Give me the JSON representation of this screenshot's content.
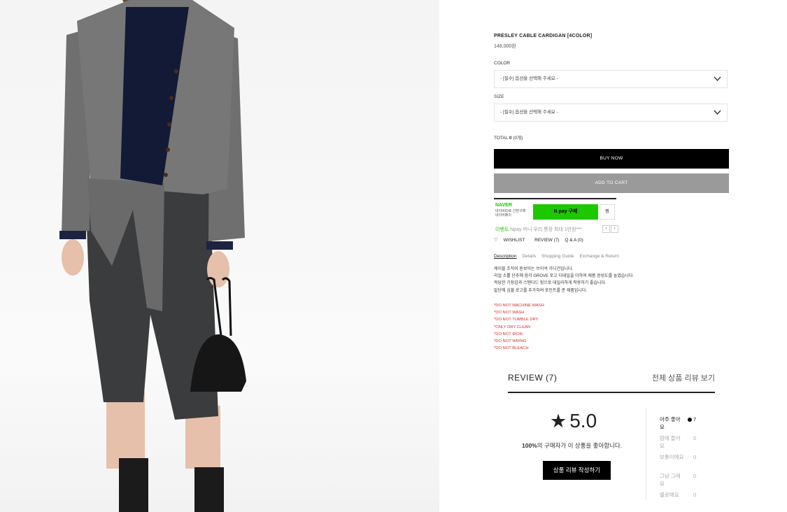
{
  "product": {
    "title": "PRESLEY CABLE CARDIGAN [4COLOR]",
    "price": "148,000원"
  },
  "options": [
    {
      "label": "COLOR",
      "placeholder": "- [필수] 옵션을 선택해 주세요 -"
    },
    {
      "label": "SIZE",
      "placeholder": "- [필수] 옵션을 선택해 주세요 -"
    }
  ],
  "total": {
    "label": "TOTAL",
    "amount": "0",
    "count": "(0개)"
  },
  "buttons": {
    "buy_now": "BUY NOW",
    "add_to_cart": "ADD TO CART"
  },
  "npay": {
    "brand": "NAVER",
    "sub_line1": "네이버ID로 간편구매",
    "sub_line2": "네이버페이",
    "pay_label": "N pay 구매",
    "zzim_label": "찜",
    "event_prefix": "이벤트",
    "event_text": "Npay 머니 우리 통장 최대 1만원***"
  },
  "links": {
    "wishlist": "WISHLIST",
    "review": "REVIEW (7)",
    "qa": "Q & A (0)"
  },
  "tabs": [
    "Description",
    "Details",
    "Shopping Guide",
    "Exchange & Return"
  ],
  "description": [
    "케이블 조직이 돋보이는 브이넥 가디건입니다.",
    "리얼 소뿔 단추에 음각 GROVE 로고 디테일을 더하여 제품 완성도를 높였습니다.",
    "적당한 기장감과 스탠다드 핏으로 데일리하게 착용하기 좋습니다.",
    "밑단에 심볼 로고를 추가하여 포인트를 준 제품입니다."
  ],
  "care": [
    "*DO NOT MACHINE WASH",
    "*DO NOT WASH",
    "*DO NOT TUMBLE DRY",
    "*ONLY DRY CLEAN",
    "*DO NOT IRON",
    "*DO NOT WRING",
    "*DO NOT BLEACH"
  ],
  "review": {
    "title": "REVIEW  (7)",
    "view_all": "전체 상품 리뷰 보기",
    "score": "5.0",
    "pct_bold": "100%",
    "pct_text": "의 구매자가 이 상품을 좋아합니다.",
    "write_button": "상품 리뷰 작성하기",
    "distribution": [
      {
        "label": "아주 좋아요",
        "count": "7"
      },
      {
        "label": "맘에 들어요",
        "count": "0"
      },
      {
        "label": "보통이에요",
        "count": "0"
      },
      {
        "label": "그냥 그래요",
        "count": "0"
      },
      {
        "label": "별로예요",
        "count": "0"
      }
    ]
  },
  "colors": {
    "npay_green": "#1ec800",
    "care_red": "#d62c2c",
    "cart_gray": "#9a9a9a"
  }
}
